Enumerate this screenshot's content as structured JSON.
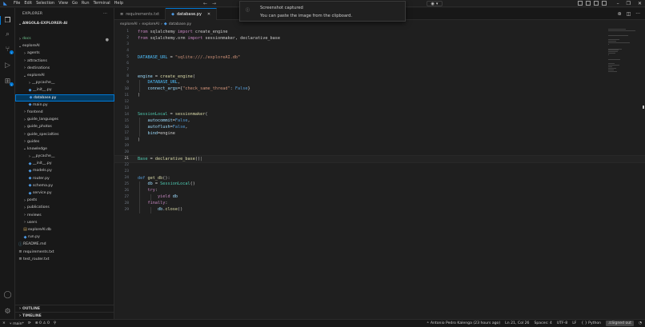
{
  "menu": [
    "File",
    "Edit",
    "Selection",
    "View",
    "Go",
    "Run",
    "Terminal",
    "Help"
  ],
  "sidebar": {
    "title": "EXPLORER",
    "root": "ANGOLA-EXPLORER-AI",
    "tree": [
      {
        "depth": 0,
        "kind": "folder",
        "open": false,
        "label": "docs",
        "color": "#73c991"
      },
      {
        "depth": 0,
        "kind": "folder",
        "open": true,
        "label": "exploreAI"
      },
      {
        "depth": 1,
        "kind": "folder",
        "open": false,
        "label": "agents"
      },
      {
        "depth": 1,
        "kind": "folder",
        "open": false,
        "label": "attractions"
      },
      {
        "depth": 1,
        "kind": "folder",
        "open": false,
        "label": "destinations"
      },
      {
        "depth": 1,
        "kind": "folder",
        "open": true,
        "label": "exploreAI"
      },
      {
        "depth": 2,
        "kind": "folder",
        "open": false,
        "label": "__pycache__"
      },
      {
        "depth": 2,
        "kind": "py",
        "label": "__init__.py"
      },
      {
        "depth": 2,
        "kind": "py",
        "label": "database.py",
        "selected": true
      },
      {
        "depth": 2,
        "kind": "py",
        "label": "main.py"
      },
      {
        "depth": 1,
        "kind": "folder",
        "open": false,
        "label": "frontend"
      },
      {
        "depth": 1,
        "kind": "folder",
        "open": false,
        "label": "guide_languages"
      },
      {
        "depth": 1,
        "kind": "folder",
        "open": false,
        "label": "guide_photos"
      },
      {
        "depth": 1,
        "kind": "folder",
        "open": false,
        "label": "guide_specialties"
      },
      {
        "depth": 1,
        "kind": "folder",
        "open": false,
        "label": "guides"
      },
      {
        "depth": 1,
        "kind": "folder",
        "open": true,
        "label": "knowledge"
      },
      {
        "depth": 2,
        "kind": "folder",
        "open": false,
        "label": "__pycache__"
      },
      {
        "depth": 2,
        "kind": "py",
        "label": "__init__.py"
      },
      {
        "depth": 2,
        "kind": "py",
        "label": "models.py"
      },
      {
        "depth": 2,
        "kind": "py",
        "label": "router.py"
      },
      {
        "depth": 2,
        "kind": "py",
        "label": "schema.py"
      },
      {
        "depth": 2,
        "kind": "py",
        "label": "service.py"
      },
      {
        "depth": 1,
        "kind": "folder",
        "open": false,
        "label": "posts"
      },
      {
        "depth": 1,
        "kind": "folder",
        "open": false,
        "label": "publications"
      },
      {
        "depth": 1,
        "kind": "folder",
        "open": false,
        "label": "reviews"
      },
      {
        "depth": 1,
        "kind": "folder",
        "open": false,
        "label": "users"
      },
      {
        "depth": 1,
        "kind": "db",
        "label": "exploreAI.db"
      },
      {
        "depth": 1,
        "kind": "py",
        "label": "run.py"
      },
      {
        "depth": 0,
        "kind": "md",
        "label": "README.md"
      },
      {
        "depth": 0,
        "kind": "txt",
        "label": "requirements.txt"
      },
      {
        "depth": 0,
        "kind": "txt",
        "label": "test_router.txt"
      }
    ],
    "outline": "OUTLINE",
    "timeline": "TIMELINE"
  },
  "tabs": [
    {
      "label": "requirements.txt",
      "icon": "≡",
      "active": false
    },
    {
      "label": "database.py",
      "icon": "◆",
      "active": true
    }
  ],
  "breadcrumb": [
    "exploreAI",
    "exploreAI",
    "database.py"
  ],
  "code": [
    [
      [
        "kw",
        "from"
      ],
      [
        "t",
        " sqlalchemy "
      ],
      [
        "kw",
        "import"
      ],
      [
        "t",
        " create_engine"
      ]
    ],
    [
      [
        "kw",
        "from"
      ],
      [
        "t",
        " sqlalchemy.orm "
      ],
      [
        "kw",
        "import"
      ],
      [
        "t",
        " sessionmaker, declarative_base"
      ]
    ],
    [],
    [],
    [
      [
        "const",
        "DATABASE_URL"
      ],
      [
        "t",
        " = "
      ],
      [
        "str",
        "\"sqlite:///./exploreAI.db\""
      ]
    ],
    [],
    [],
    [
      [
        "var",
        "engine"
      ],
      [
        "t",
        " = "
      ],
      [
        "fn",
        "create_engine"
      ],
      [
        "t",
        "("
      ]
    ],
    [
      [
        "t",
        "    "
      ],
      [
        "const",
        "DATABASE_URL"
      ],
      [
        "t",
        ","
      ]
    ],
    [
      [
        "t",
        "    "
      ],
      [
        "var",
        "connect_args"
      ],
      [
        "t",
        "={"
      ],
      [
        "str",
        "\"check_same_thread\""
      ],
      [
        "t",
        ": "
      ],
      [
        "kw2",
        "False"
      ],
      [
        "t",
        "}"
      ]
    ],
    [
      [
        "t",
        ")"
      ]
    ],
    [],
    [],
    [
      [
        "cls",
        "SessionLocal"
      ],
      [
        "t",
        " = "
      ],
      [
        "fn",
        "sessionmaker"
      ],
      [
        "t",
        "("
      ]
    ],
    [
      [
        "t",
        "    "
      ],
      [
        "var",
        "autocommit"
      ],
      [
        "t",
        "="
      ],
      [
        "kw2",
        "False"
      ],
      [
        "t",
        ","
      ]
    ],
    [
      [
        "t",
        "    "
      ],
      [
        "var",
        "autoflush"
      ],
      [
        "t",
        "="
      ],
      [
        "kw2",
        "False"
      ],
      [
        "t",
        ","
      ]
    ],
    [
      [
        "t",
        "    "
      ],
      [
        "var",
        "bind"
      ],
      [
        "t",
        "=engine"
      ]
    ],
    [
      [
        "t",
        ")"
      ]
    ],
    [],
    [],
    [
      [
        "cls",
        "Base"
      ],
      [
        "t",
        " = "
      ],
      [
        "fn",
        "declarative_base"
      ],
      [
        "t",
        "()"
      ]
    ],
    [],
    [],
    [
      [
        "kw2",
        "def"
      ],
      [
        "t",
        " "
      ],
      [
        "fn",
        "get_db"
      ],
      [
        "t",
        "():"
      ]
    ],
    [
      [
        "t",
        "    "
      ],
      [
        "var",
        "db"
      ],
      [
        "t",
        " = "
      ],
      [
        "cls",
        "SessionLocal"
      ],
      [
        "t",
        "()"
      ]
    ],
    [
      [
        "t",
        "    "
      ],
      [
        "kw",
        "try"
      ],
      [
        "t",
        ":"
      ]
    ],
    [
      [
        "t",
        "        "
      ],
      [
        "kw",
        "yield"
      ],
      [
        "t",
        " "
      ],
      [
        "var",
        "db"
      ]
    ],
    [
      [
        "t",
        "    "
      ],
      [
        "kw",
        "finally"
      ],
      [
        "t",
        ":"
      ]
    ],
    [
      [
        "t",
        "        "
      ],
      [
        "var",
        "db"
      ],
      [
        "t",
        "."
      ],
      [
        "fn",
        "close"
      ],
      [
        "t",
        "()"
      ]
    ]
  ],
  "current_line": 21,
  "notification": {
    "title": "Screenshot captured",
    "message": "You can paste the image from the clipboard."
  },
  "statusbar": {
    "branch": "main*",
    "problems": "⊗ 0 ⚠ 0",
    "blame": "Antonio Pedro Kalenga (23 hours ago)",
    "position": "Ln 21, Col 26",
    "spaces": "Spaces: 4",
    "encoding": "UTF-8",
    "eol": "LF",
    "language": "{ } Python",
    "account": "Signed out"
  },
  "colors": {
    "accent": "#0078d4",
    "keyword": "#c586c0",
    "string": "#ce9178",
    "function": "#dcdcaa"
  }
}
